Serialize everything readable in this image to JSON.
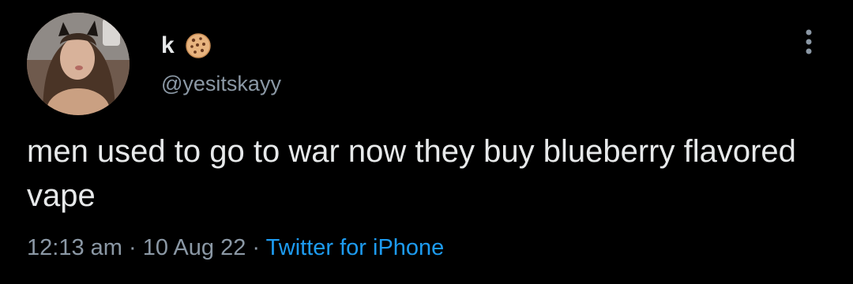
{
  "user": {
    "display_name": "k",
    "emoji_icon": "cookie-icon",
    "handle": "@yesitskayy"
  },
  "tweet": {
    "text": "men used to go to war now they buy blueberry flavored vape",
    "time": "12:13 am",
    "separator": "·",
    "date": "10 Aug 22",
    "source": "Twitter for iPhone"
  },
  "colors": {
    "background": "#000000",
    "text": "#e7e9ea",
    "muted": "#8b98a5",
    "link": "#1d9bf0"
  }
}
